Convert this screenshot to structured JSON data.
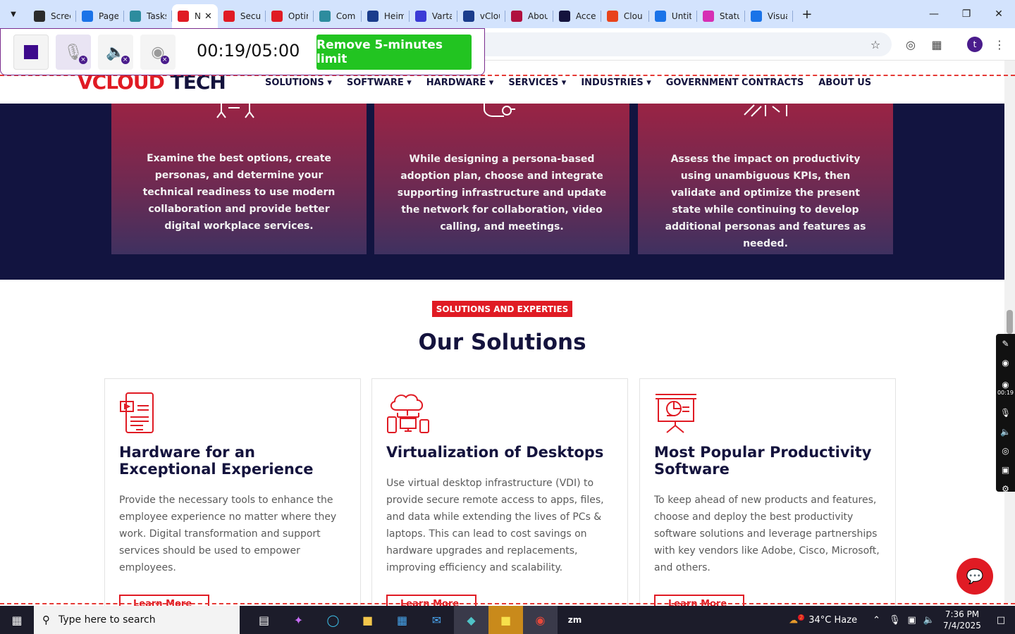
{
  "browser": {
    "tabs": [
      {
        "title": "Scree",
        "color": "#2b2b2b"
      },
      {
        "title": "Page",
        "color": "#1a73e8"
      },
      {
        "title": "Tasks",
        "color": "#2d8c9e"
      },
      {
        "title": "N",
        "color": "#e01b24",
        "active": true
      },
      {
        "title": "Secu",
        "color": "#e01b24"
      },
      {
        "title": "Optir",
        "color": "#e01b24"
      },
      {
        "title": "Com",
        "color": "#2d8c9e"
      },
      {
        "title": "Heim",
        "color": "#1a3c8c"
      },
      {
        "title": "Varta",
        "color": "#3b3bd6"
      },
      {
        "title": "vClou",
        "color": "#1a3c8c"
      },
      {
        "title": "Abou",
        "color": "#b01040"
      },
      {
        "title": "Acce",
        "color": "#14133d"
      },
      {
        "title": "Clou",
        "color": "#e8431b"
      },
      {
        "title": "Untit",
        "color": "#1a73e8"
      },
      {
        "title": "Statu",
        "color": "#d62fb4"
      },
      {
        "title": "Visua",
        "color": "#1a73e8"
      }
    ],
    "new_tab": "+",
    "avatar_letter": "t"
  },
  "recorder": {
    "timer": "00:19/05:00",
    "limit_label": "Remove 5-minutes limit"
  },
  "site": {
    "logo_main": "VCLOUD",
    "logo_accent": "TECH",
    "nav": [
      "SOLUTIONS",
      "SOFTWARE",
      "HARDWARE",
      "SERVICES",
      "INDUSTRIES",
      "GOVERNMENT CONTRACTS",
      "ABOUT US"
    ]
  },
  "dark_cards": [
    {
      "text": "Examine the best options, create personas, and determine your technical readiness to use modern collaboration and provide better digital workplace services."
    },
    {
      "text": "While designing a persona-based adoption plan, choose and integrate supporting infrastructure and update the network for collaboration, video calling, and meetings."
    },
    {
      "text": "Assess the impact on productivity using unambiguous KPIs, then validate and optimize the present state while continuing to develop additional personas and features as needed."
    }
  ],
  "solutions": {
    "badge": "SOLUTIONS AND EXPERTIES",
    "title": "Our Solutions",
    "cards": [
      {
        "title": "Hardware for an Exceptional Experience",
        "text": "Provide the necessary tools to enhance the employee experience no matter where they work. Digital transformation and support services should be used to empower employees.",
        "cta": "Learn More"
      },
      {
        "title": "Virtualization of Desktops",
        "text": "Use virtual desktop infrastructure (VDI) to provide secure remote access to apps, files, and data while extending the lives of PCs & laptops. This can lead to cost savings on hardware upgrades and replacements, improving efficiency and scalability.",
        "cta": "Learn More"
      },
      {
        "title": "Most Popular Productivity Software",
        "text": "To keep ahead of new products and features, choose and deploy the best productivity software solutions and leverage partnerships with key vendors like Adobe, Cisco, Microsoft, and others.",
        "cta": "Learn More"
      }
    ]
  },
  "side_tools": {
    "timer": "00:19"
  },
  "taskbar": {
    "search_placeholder": "Type here to search",
    "weather": "34°C  Haze",
    "weather_badge": "2",
    "time": "7:36 PM",
    "date": "7/4/2025"
  }
}
